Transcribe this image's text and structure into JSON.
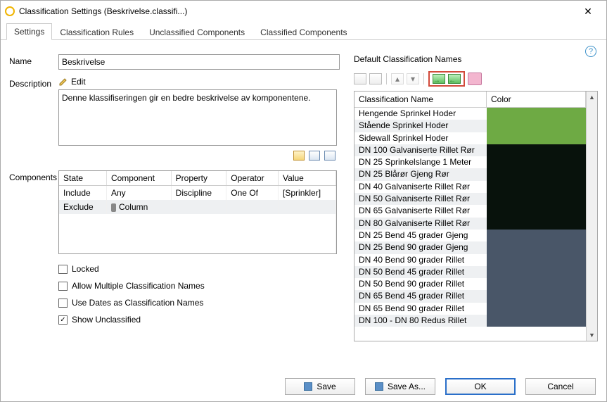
{
  "window": {
    "title": "Classification Settings (Beskrivelse.classifi...)"
  },
  "tabs": [
    "Settings",
    "Classification Rules",
    "Unclassified Components",
    "Classified Components"
  ],
  "labels": {
    "name": "Name",
    "description": "Description",
    "edit": "Edit",
    "components": "Components",
    "default_group": "Default Classification Names"
  },
  "name_value": "Beskrivelse",
  "description_value": "Denne klassifiseringen gir en bedre beskrivelse av komponentene.",
  "comp_headers": [
    "State",
    "Component",
    "Property",
    "Operator",
    "Value"
  ],
  "comp_rows": [
    {
      "state": "Include",
      "component": "Any",
      "property": "Discipline",
      "operator": "One Of",
      "value": "[Sprinkler]"
    },
    {
      "state": "Exclude",
      "component": "Column",
      "property": "",
      "operator": "",
      "value": ""
    }
  ],
  "checks": {
    "locked": "Locked",
    "multi": "Allow Multiple Classification Names",
    "dates": "Use Dates as Classification Names",
    "unclassified": "Show Unclassified"
  },
  "check_state": {
    "locked": false,
    "multi": false,
    "dates": false,
    "unclassified": true
  },
  "grid_headers": {
    "name": "Classification Name",
    "color": "Color"
  },
  "rows": [
    {
      "name": "Hengende Sprinkel Hoder",
      "color": "#6eaa44"
    },
    {
      "name": "Stående Sprinkel Hoder",
      "color": "#6eaa44"
    },
    {
      "name": "Sidewall Sprinkel Hoder",
      "color": "#6eaa44"
    },
    {
      "name": "DN 100 Galvaniserte Rillet Rør",
      "color": "#08120c"
    },
    {
      "name": "DN 25 Sprinkelslange 1 Meter",
      "color": "#08120c"
    },
    {
      "name": "DN 25 Blårør Gjeng Rør",
      "color": "#08120c"
    },
    {
      "name": "DN 40 Galvaniserte Rillet Rør",
      "color": "#08120c"
    },
    {
      "name": "DN 50 Galvaniserte Rillet Rør",
      "color": "#08120c"
    },
    {
      "name": "DN 65 Galvaniserte Rillet Rør",
      "color": "#08120c"
    },
    {
      "name": "DN 80 Galvaniserte Rillet Rør",
      "color": "#08120c"
    },
    {
      "name": "DN 25 Bend 45 grader Gjeng",
      "color": "#495668"
    },
    {
      "name": "DN 25 Bend 90 grader Gjeng",
      "color": "#495668"
    },
    {
      "name": "DN 40 Bend 90 grader Rillet",
      "color": "#495668"
    },
    {
      "name": "DN 50 Bend 45 grader Rillet",
      "color": "#495668"
    },
    {
      "name": "DN 50 Bend 90 grader Rillet",
      "color": "#495668"
    },
    {
      "name": "DN 65 Bend 45 grader Rillet",
      "color": "#495668"
    },
    {
      "name": "DN 65 Bend 90 grader Rillet",
      "color": "#495668"
    },
    {
      "name": "DN 100 - DN 80 Redus Rillet",
      "color": "#495668"
    }
  ],
  "footer": {
    "save": "Save",
    "save_as": "Save As...",
    "ok": "OK",
    "cancel": "Cancel"
  }
}
